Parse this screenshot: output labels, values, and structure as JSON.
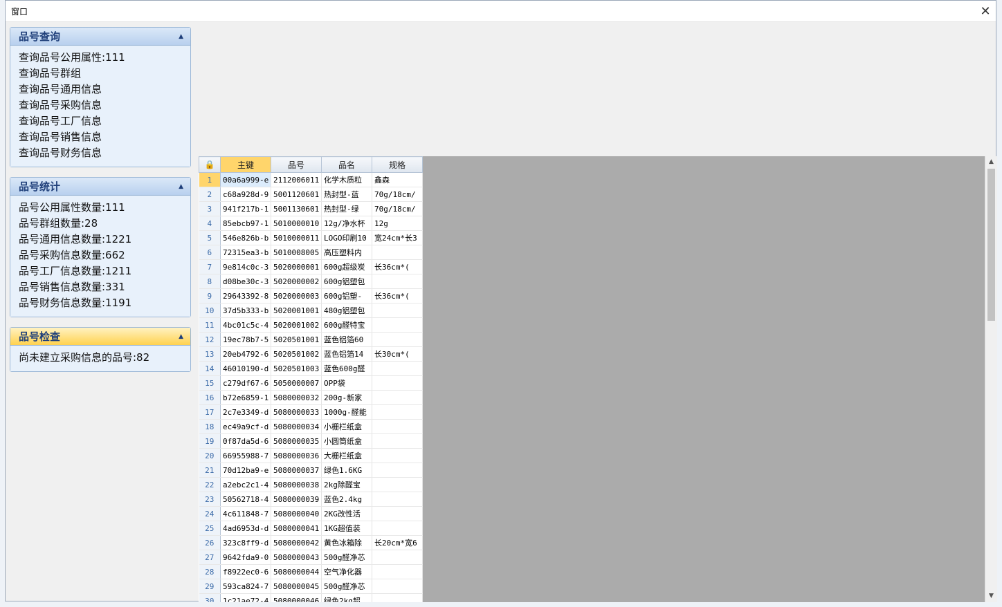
{
  "window": {
    "title": "窗口",
    "close_glyph": "✕"
  },
  "groups": [
    {
      "title": "品号查询",
      "items": [
        "查询品号公用属性:111",
        "查询品号群组",
        "查询品号通用信息",
        "查询品号采购信息",
        "查询品号工厂信息",
        "查询品号销售信息",
        "查询品号财务信息"
      ]
    },
    {
      "title": "品号统计",
      "items": [
        "品号公用属性数量:111",
        "品号群组数量:28",
        "品号通用信息数量:1221",
        "品号采购信息数量:662",
        "品号工厂信息数量:1211",
        "品号销售信息数量:331",
        "品号财务信息数量:1191"
      ]
    },
    {
      "title": "品号检查",
      "items": [
        "尚未建立采购信息的品号:82"
      ]
    }
  ],
  "grid": {
    "columns": [
      "主键",
      "品号",
      "品名",
      "规格"
    ],
    "rows": [
      [
        "1",
        "00a6a999-e",
        "2112006011",
        "化学木质粒",
        "鑫森"
      ],
      [
        "2",
        "c68a928d-9",
        "5001120601",
        "热封型-蓝",
        "70g/18cm/"
      ],
      [
        "3",
        "941f217b-1",
        "5001130601",
        "热封型-绿",
        "70g/18cm/"
      ],
      [
        "4",
        "85ebcb97-1",
        "5010000010",
        "12g/净水杯",
        "12g"
      ],
      [
        "5",
        "546e826b-b",
        "5010000011",
        "LOGO印刷10",
        "宽24cm*长3"
      ],
      [
        "6",
        "72315ea3-b",
        "5010008005",
        "高压塑料内",
        ""
      ],
      [
        "7",
        "9e814c0c-3",
        "5020000001",
        "600g超级炭",
        "长36cm*("
      ],
      [
        "8",
        "d08be30c-3",
        "5020000002",
        "600g铝塑包",
        ""
      ],
      [
        "9",
        "29643392-8",
        "5020000003",
        "600g铝塑-",
        "长36cm*("
      ],
      [
        "10",
        "37d5b333-b",
        "5020001001",
        "480g铝塑包",
        ""
      ],
      [
        "11",
        "4bc01c5c-4",
        "5020001002",
        "600g醛特宝",
        ""
      ],
      [
        "12",
        "19ec78b7-5",
        "5020501001",
        "蓝色铝箔60",
        ""
      ],
      [
        "13",
        "20eb4792-6",
        "5020501002",
        "蓝色铝箔14",
        "长30cm*("
      ],
      [
        "14",
        "46010190-d",
        "5020501003",
        "蓝色600g醛",
        ""
      ],
      [
        "15",
        "c279df67-6",
        "5050000007",
        "OPP袋",
        ""
      ],
      [
        "16",
        "b72e6859-1",
        "5080000032",
        "200g-新家",
        ""
      ],
      [
        "17",
        "2c7e3349-d",
        "5080000033",
        "1000g-醛能",
        ""
      ],
      [
        "18",
        "ec49a9cf-d",
        "5080000034",
        "小栅栏纸盒",
        ""
      ],
      [
        "19",
        "0f87da5d-6",
        "5080000035",
        "小圆筒纸盒",
        ""
      ],
      [
        "20",
        "66955988-7",
        "5080000036",
        "大栅栏纸盒",
        ""
      ],
      [
        "21",
        "70d12ba9-e",
        "5080000037",
        "绿色1.6KG",
        ""
      ],
      [
        "22",
        "a2ebc2c1-4",
        "5080000038",
        "2kg除醛宝",
        ""
      ],
      [
        "23",
        "50562718-4",
        "5080000039",
        "蓝色2.4kg",
        ""
      ],
      [
        "24",
        "4c611848-7",
        "5080000040",
        "2KG改性活",
        ""
      ],
      [
        "25",
        "4ad6953d-d",
        "5080000041",
        "1KG超值装",
        ""
      ],
      [
        "26",
        "323c8ff9-d",
        "5080000042",
        "黄色冰箱除",
        "长20cm*宽6"
      ],
      [
        "27",
        "9642fda9-0",
        "5080000043",
        "500g醛净芯",
        ""
      ],
      [
        "28",
        "f8922ec0-6",
        "5080000044",
        "空气净化器",
        ""
      ],
      [
        "29",
        "593ca824-7",
        "5080000045",
        "500g醛净芯",
        ""
      ],
      [
        "30",
        "1c21ae72-4",
        "5080000046",
        "绿色2kg超",
        ""
      ]
    ]
  }
}
